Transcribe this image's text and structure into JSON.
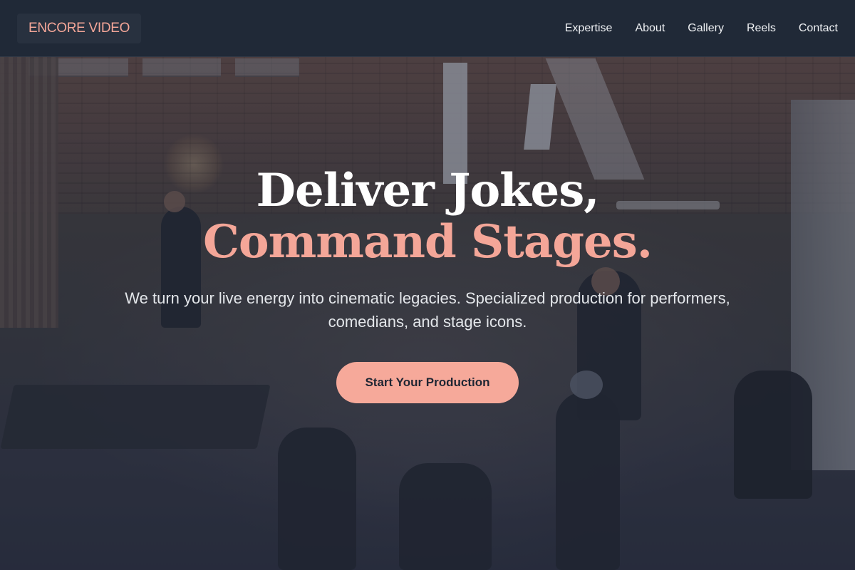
{
  "brand": {
    "logo_text": "ENCORE VIDEO",
    "accent_color": "#f4a698"
  },
  "nav": {
    "links": [
      "Expertise",
      "About",
      "Gallery",
      "Reels",
      "Contact"
    ]
  },
  "hero": {
    "headline_line1": "Deliver Jokes,",
    "headline_line2": "Command Stages.",
    "subtitle": "We turn your live energy into cinematic legacies. Specialized production for performers, comedians, and stage icons.",
    "cta_label": "Start Your Production",
    "background": "film-set-photo"
  }
}
